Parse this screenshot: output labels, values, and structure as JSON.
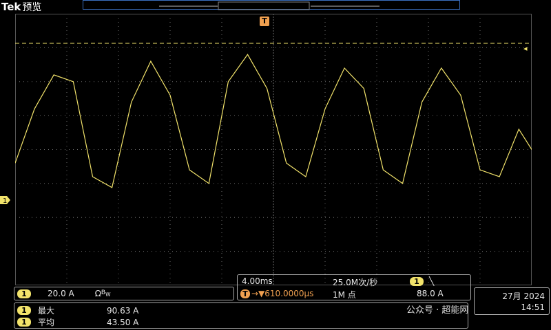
{
  "header": {
    "brand": "Tek",
    "mode": "预览"
  },
  "trigger_marker": {
    "label": "T"
  },
  "channel": {
    "id": "1",
    "scale": "20.0 A",
    "coupling_symbol": "Ω",
    "bw_symbol": "B",
    "bw_sub": "W"
  },
  "timebase": {
    "scale": "4.00ms",
    "sample_rate": "25.0M次/秒",
    "trigger_badge": "T",
    "trigger_delay": "→▼610.0000µs",
    "record_length": "1M 点",
    "trigger_source": "1",
    "trigger_slope": "╲",
    "trigger_level": "88.0 A"
  },
  "measurements": [
    {
      "ch": "1",
      "label": "最大",
      "value": "90.63 A"
    },
    {
      "ch": "1",
      "label": "平均",
      "value": "43.50 A"
    }
  ],
  "date": {
    "line1": "27月 2024",
    "line2": "14:51"
  },
  "watermark": {
    "text": "公众号 · 超能网"
  },
  "colors": {
    "trace": "#f2e36b",
    "grid": "#6b6b6b",
    "trigger": "#f0a050",
    "accent": "#3a6fc0"
  },
  "chart_data": {
    "type": "line",
    "title": "",
    "xlabel": "",
    "ylabel": "",
    "xlim": [
      -0.02,
      0.02
    ],
    "ylim": [
      -90,
      110
    ],
    "grid": true,
    "series": [
      {
        "x": [
          -0.02,
          -0.0185,
          -0.017,
          -0.0155,
          -0.014,
          -0.0125,
          -0.011,
          -0.0095,
          -0.008,
          -0.0065,
          -0.005,
          -0.0035,
          -0.002,
          -0.0005,
          0.001,
          0.0025,
          0.004,
          0.0055,
          0.007,
          0.0085,
          0.01,
          0.0115,
          0.013,
          0.0145,
          0.016,
          0.0175,
          0.019,
          0.02
        ],
        "y": [
          0,
          40,
          65,
          60,
          -10,
          -18,
          45,
          75,
          50,
          -5,
          -15,
          60,
          80,
          55,
          0,
          -10,
          40,
          70,
          55,
          -5,
          -15,
          45,
          70,
          50,
          -5,
          -10,
          25,
          10
        ]
      }
    ]
  }
}
